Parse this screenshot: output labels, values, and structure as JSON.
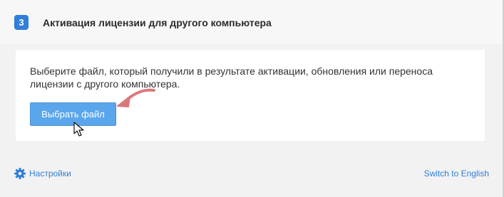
{
  "step": {
    "number": "3",
    "title": "Активация лицензии для другого компьютера"
  },
  "card": {
    "instruction": "Выберите файл, который получили в результате активации, обновления или переноса лицензии с другого компьютера.",
    "select_file_label": "Выбрать файл"
  },
  "footer": {
    "settings_label": "Настройки",
    "switch_language_label": "Switch to English"
  },
  "colors": {
    "accent": "#2f7ed8",
    "button": "#5aa6ec",
    "hint_arrow": "#d9777a"
  },
  "icons": {
    "settings": "gear-icon",
    "hint": "curved-arrow-icon",
    "pointer": "mouse-cursor-icon"
  }
}
